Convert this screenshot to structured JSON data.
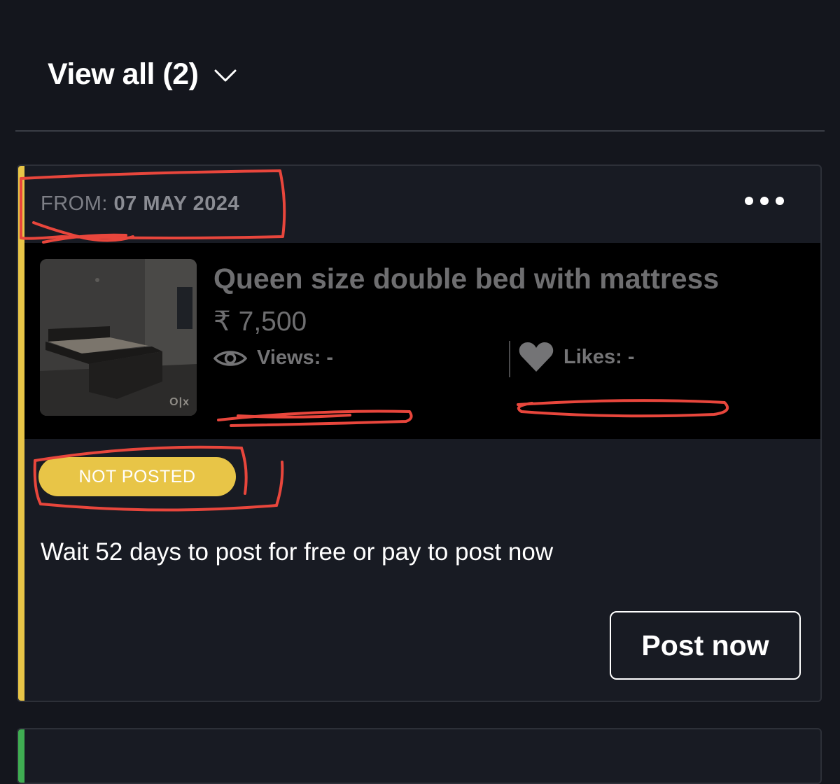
{
  "header": {
    "view_all_label": "View all (2)"
  },
  "listing_card": {
    "accent_color": "#e8c547",
    "from_prefix": "FROM:",
    "from_date": "07 MAY  2024",
    "title": "Queen size double bed with mattress",
    "price": "₹ 7,500",
    "views_text": "Views: -",
    "likes_text": "Likes: -",
    "thumb_watermark": "O|x",
    "status_badge": "NOT POSTED",
    "status_color": "#e8c547",
    "message": "Wait 52 days to post for free or pay to post now",
    "post_button": "Post now"
  },
  "next_card": {
    "accent_color": "#3fae52"
  },
  "annotation_color": "#e8463c"
}
